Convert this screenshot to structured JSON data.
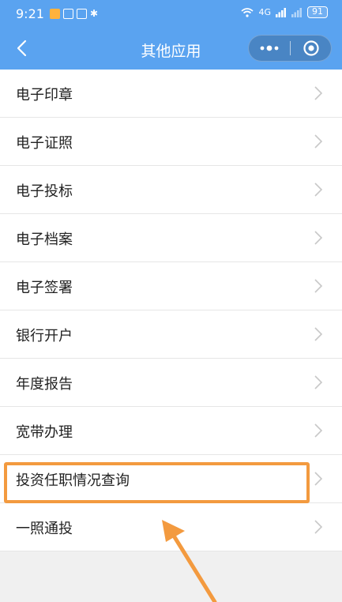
{
  "status_bar": {
    "time": "9:21",
    "network": "4G",
    "battery": "91"
  },
  "navbar": {
    "title": "其他应用",
    "more_icon": "more-dots-icon",
    "close_icon": "target-close-icon"
  },
  "list": {
    "items": [
      {
        "label": "电子印章"
      },
      {
        "label": "电子证照"
      },
      {
        "label": "电子投标"
      },
      {
        "label": "电子档案"
      },
      {
        "label": "电子签署"
      },
      {
        "label": "银行开户"
      },
      {
        "label": "年度报告"
      },
      {
        "label": "宽带办理"
      },
      {
        "label": "投资任职情况查询"
      },
      {
        "label": "一照通投"
      }
    ]
  },
  "colors": {
    "header": "#5aa3f0",
    "highlight": "#f39a3f",
    "background": "#f0f0f0"
  }
}
